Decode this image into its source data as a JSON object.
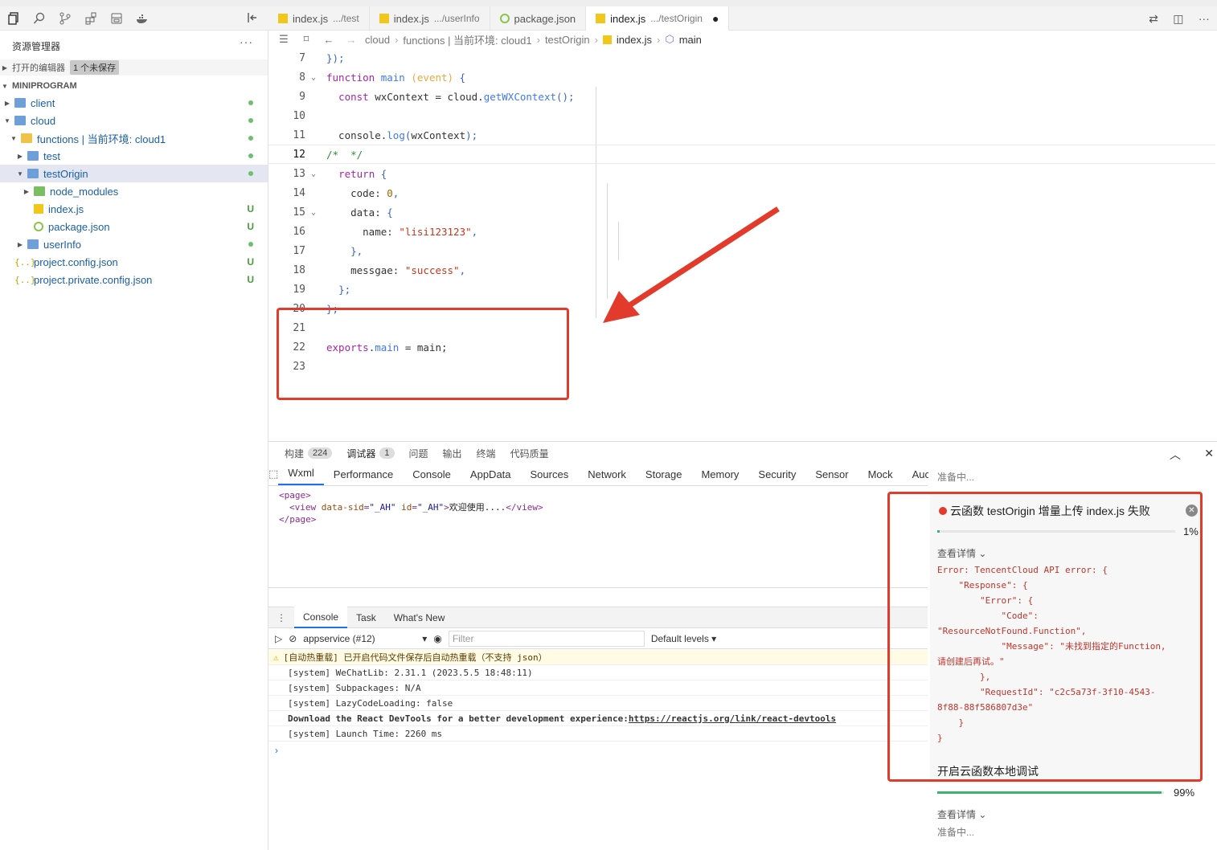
{
  "explorer": {
    "title": "资源管理器",
    "more": "···",
    "open_editors": "打开的编辑器",
    "unsaved_badge": "1 个未保存",
    "project": "MINIPROGRAM",
    "tree": [
      {
        "name": "client",
        "depth": 1,
        "type": "folder",
        "expanded": false,
        "status": "dot"
      },
      {
        "name": "cloud",
        "depth": 1,
        "type": "folder",
        "expanded": true,
        "status": "dot"
      },
      {
        "name": "functions | 当前环境: cloud1",
        "depth": 2,
        "type": "folder-open",
        "expanded": true,
        "status": "dot"
      },
      {
        "name": "test",
        "depth": 3,
        "type": "folder",
        "expanded": false,
        "status": "dot"
      },
      {
        "name": "testOrigin",
        "depth": 3,
        "type": "folder",
        "expanded": true,
        "status": "dot",
        "selected": true
      },
      {
        "name": "node_modules",
        "depth": 4,
        "type": "folder-green",
        "expanded": false,
        "status": ""
      },
      {
        "name": "index.js",
        "depth": 4,
        "type": "js",
        "status": "U"
      },
      {
        "name": "package.json",
        "depth": 4,
        "type": "pkg",
        "status": "U"
      },
      {
        "name": "userInfo",
        "depth": 3,
        "type": "folder",
        "expanded": false,
        "status": "dot"
      },
      {
        "name": "project.config.json",
        "depth": 1,
        "type": "json",
        "status": "U"
      },
      {
        "name": "project.private.config.json",
        "depth": 1,
        "type": "json",
        "status": "U"
      }
    ]
  },
  "tabs": [
    {
      "label": "index.js",
      "sub": ".../test",
      "icon": "js"
    },
    {
      "label": "index.js",
      "sub": ".../userInfo",
      "icon": "js"
    },
    {
      "label": "package.json",
      "sub": "",
      "icon": "pkg"
    },
    {
      "label": "index.js",
      "sub": ".../testOrigin",
      "icon": "js",
      "active": true,
      "modified": "●"
    }
  ],
  "breadcrumb": {
    "items": [
      "cloud",
      "functions | 当前环境: cloud1",
      "testOrigin",
      "index.js",
      "main"
    ]
  },
  "editor": {
    "lines": [
      {
        "n": "7"
      },
      {
        "n": "8"
      },
      {
        "n": "9"
      },
      {
        "n": "10"
      },
      {
        "n": "11"
      },
      {
        "n": "12"
      },
      {
        "n": "13"
      },
      {
        "n": "14"
      },
      {
        "n": "15"
      },
      {
        "n": "16"
      },
      {
        "n": "17"
      },
      {
        "n": "18"
      },
      {
        "n": "19"
      },
      {
        "n": "20"
      },
      {
        "n": "21"
      },
      {
        "n": "22"
      },
      {
        "n": "23"
      }
    ],
    "current_line": "12"
  },
  "panel": {
    "tabs": [
      {
        "label": "构建",
        "count": "224"
      },
      {
        "label": "调试器",
        "count": "1",
        "active": true
      },
      {
        "label": "问题"
      },
      {
        "label": "输出"
      },
      {
        "label": "终端"
      },
      {
        "label": "代码质量"
      }
    ]
  },
  "devtools": {
    "tabs": [
      "Wxml",
      "Performance",
      "Console",
      "AppData",
      "Sources",
      "Network",
      "Storage",
      "Memory",
      "Security",
      "Sensor",
      "Mock",
      "Auc"
    ],
    "active": "Wxml",
    "wxml": {
      "open": "<page>",
      "view_open": "<view",
      "attr1": "data-sid",
      "val1": "\"_AH\"",
      "attr2": "id",
      "val2": "\"_AH\"",
      "text": "欢迎使用....",
      "view_close": "</view>",
      "close": "</page>"
    }
  },
  "console": {
    "tabs": [
      "Console",
      "Task",
      "What's New"
    ],
    "context": "appservice (#12)",
    "filter_placeholder": "Filter",
    "levels": "Default levels ▾",
    "logs": [
      {
        "kind": "warn",
        "text": "[自动热重载] 已开启代码文件保存后自动热重载（不支持 json）"
      },
      {
        "kind": "info",
        "text": "[system] WeChatLib: 2.31.1 (2023.5.5 18:48:11)"
      },
      {
        "kind": "info",
        "text": "[system] Subpackages: N/A"
      },
      {
        "kind": "info",
        "text": "[system] LazyCodeLoading: false"
      },
      {
        "kind": "bold",
        "text": "Download the React DevTools for a better development experience: ",
        "link": "https://reactjs.org/link/react-devtools"
      },
      {
        "kind": "info",
        "text": "[system] Launch Time: 2260 ms"
      }
    ],
    "prompt": "›"
  },
  "notification": {
    "preparing_top": "准备中...",
    "title": "云函数 testOrigin 增量上传 index.js 失败",
    "progress1": "1%",
    "progress1_value": 0.01,
    "details": "查看详情",
    "error": "Error: TencentCloud API error: {\n    \"Response\": {\n        \"Error\": {\n            \"Code\":\n\"ResourceNotFound.Function\",\n            \"Message\": \"未找到指定的Function,\n请创建后再试。\"\n        },\n        \"RequestId\": \"c2c5a73f-3f10-4543-\n8f88-88f586807d3e\"\n    }\n}",
    "title2": "开启云函数本地调试",
    "progress2": "99%",
    "progress2_value": 0.99,
    "details2": "查看详情",
    "preparing_bottom": "准备中..."
  },
  "colors": {
    "accent": "#1a73e8",
    "error": "#e23a2b",
    "success": "#3cb371"
  }
}
